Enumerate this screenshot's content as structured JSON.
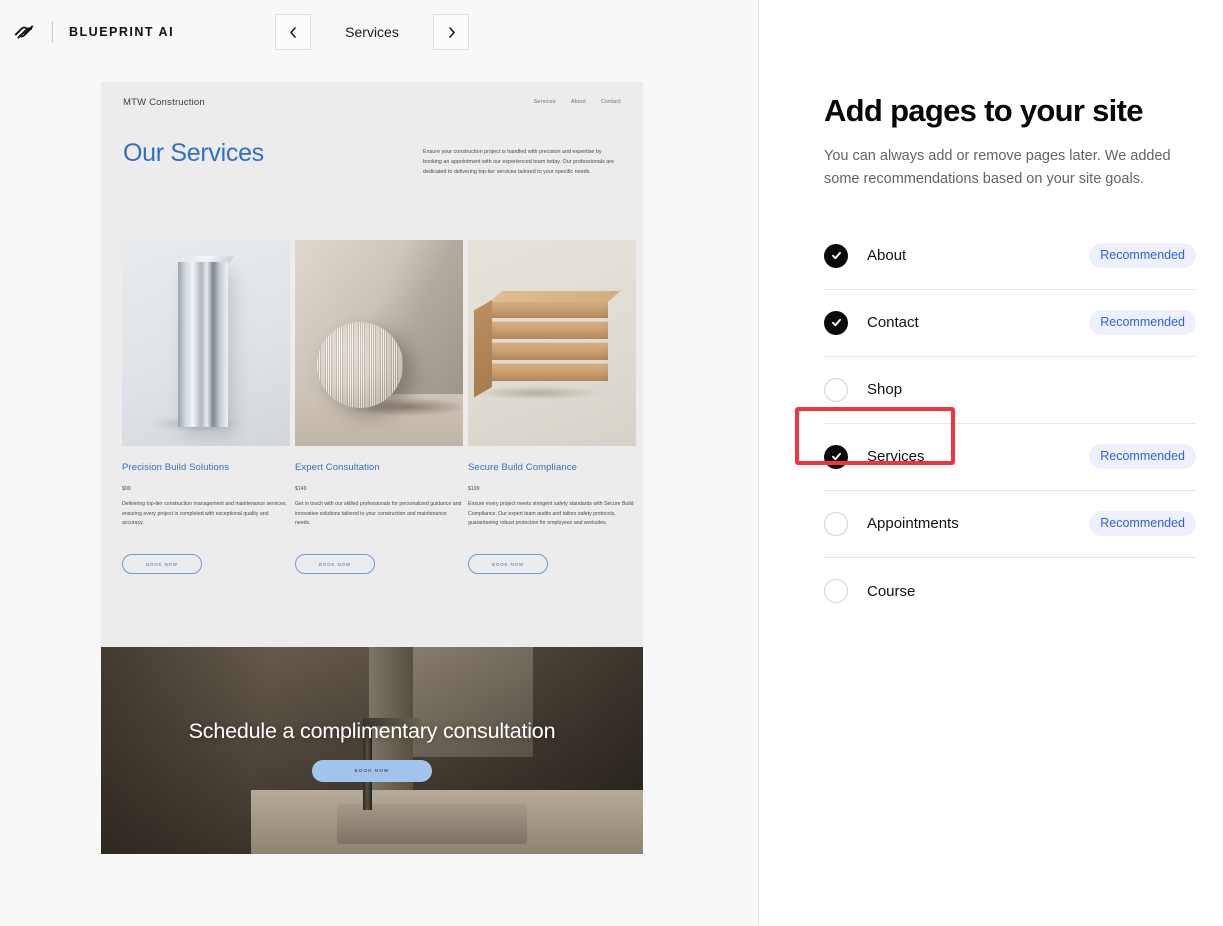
{
  "topbar": {
    "logo_icon": "squarespace-logo-icon",
    "brand_name": "BLUEPRINT AI",
    "prev_icon": "chevron-left-icon",
    "next_icon": "chevron-right-icon",
    "current_page": "Services"
  },
  "preview": {
    "site_name": "MTW Construction",
    "nav_links": [
      "Services",
      "About",
      "Contact"
    ],
    "hero_title": "Our Services",
    "hero_paragraph": "Ensure your construction project is handled with precision and expertise by booking an appointment with our experienced team today. Our professionals are dedicated to delivering top-tier services tailored to your specific needs.",
    "cards": [
      {
        "image": "metal-column-image",
        "title": "Precision Build Solutions",
        "price": "$99",
        "description": "Delivering top-tier construction management and maintenance services, ensuring every project is completed with exceptional quality and accuracy.",
        "button": "BOOK NOW"
      },
      {
        "image": "ribbed-sphere-image",
        "title": "Expert Consultation",
        "price": "$149",
        "description": "Get in touch with our skilled professionals for personalized guidance and innovative solutions tailored to your construction and maintenance needs.",
        "button": "BOOK NOW"
      },
      {
        "image": "lumber-stack-image",
        "title": "Secure Build Compliance",
        "price": "$199",
        "description": "Ensure every project meets stringent safety standards with Secure Build Compliance. Our expert team audits and tailors safety protocols, guaranteeing robust protection for employees and worksites.",
        "button": "BOOK NOW"
      }
    ],
    "banner": {
      "title": "Schedule a complimentary consultation",
      "button": "BOOK NOW",
      "button_color": "#a3c4ea"
    }
  },
  "panel": {
    "title": "Add pages to your site",
    "subtitle": "You can always add or remove pages later. We added some recommendations based on your site goals.",
    "badge_label": "Recommended",
    "badge_color": "#2f62d4",
    "badge_bg": "#eef1fc",
    "highlight_color": "#f5333f",
    "pages": [
      {
        "label": "About",
        "checked": true,
        "badge": "Recommended",
        "highlighted": false
      },
      {
        "label": "Contact",
        "checked": true,
        "badge": "Recommended",
        "highlighted": false
      },
      {
        "label": "Shop",
        "checked": false,
        "badge": "",
        "highlighted": false
      },
      {
        "label": "Services",
        "checked": true,
        "badge": "Recommended",
        "highlighted": true
      },
      {
        "label": "Appointments",
        "checked": false,
        "badge": "Recommended",
        "highlighted": false
      },
      {
        "label": "Course",
        "checked": false,
        "badge": "",
        "highlighted": false
      }
    ]
  }
}
